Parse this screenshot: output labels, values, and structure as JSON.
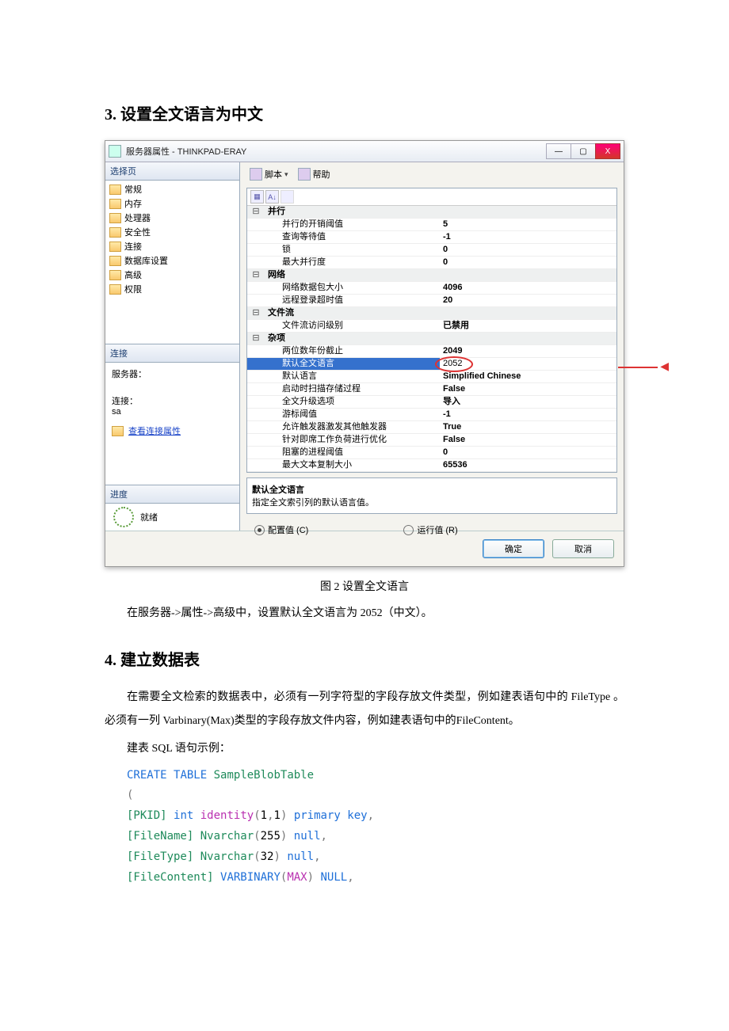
{
  "headings": {
    "h3": "3.  设置全文语言为中文",
    "h4": "4.  建立数据表"
  },
  "dialog": {
    "title": "服务器属性 - THINKPAD-ERAY",
    "winbtns": {
      "min": "—",
      "max": "▢",
      "close": "X"
    },
    "left": {
      "select_page": "选择页",
      "pages": [
        "常规",
        "内存",
        "处理器",
        "安全性",
        "连接",
        "数据库设置",
        "高级",
        "权限"
      ],
      "conn_hdr": "连接",
      "server_lbl": "服务器：",
      "conn_lbl": "连接：",
      "conn_val": "sa",
      "view_link": "查看连接属性",
      "progress_hdr": "进度",
      "progress_val": "就绪"
    },
    "right": {
      "script": "脚本",
      "script_drop": "▾",
      "help": "帮助",
      "cats": [
        {
          "name": "并行",
          "rows": [
            [
              "并行的开销阈值",
              "5"
            ],
            [
              "查询等待值",
              "-1"
            ],
            [
              "锁",
              "0"
            ],
            [
              "最大并行度",
              "0"
            ]
          ]
        },
        {
          "name": "网络",
          "rows": [
            [
              "网络数据包大小",
              "4096"
            ],
            [
              "远程登录超时值",
              "20"
            ]
          ]
        },
        {
          "name": "文件流",
          "rows": [
            [
              "文件流访问级别",
              "已禁用"
            ]
          ]
        },
        {
          "name": "杂项",
          "rows": [
            [
              "两位数年份截止",
              "2049"
            ],
            [
              "默认全文语言",
              "2052"
            ],
            [
              "默认语言",
              "Simplified Chinese"
            ],
            [
              "启动时扫描存储过程",
              "False"
            ],
            [
              "全文升级选项",
              "导入"
            ],
            [
              "游标阈值",
              "-1"
            ],
            [
              "允许触发器激发其他触发器",
              "True"
            ],
            [
              "针对即席工作负荷进行优化",
              "False"
            ],
            [
              "阻塞的进程阈值",
              "0"
            ],
            [
              "最大文本复制大小",
              "65536"
            ]
          ]
        }
      ],
      "desc_title": "默认全文语言",
      "desc_body": "指定全文索引列的默认语言值。",
      "radio_cfg": "配置值 (C)",
      "radio_run": "运行值 (R)",
      "ok": "确定",
      "cancel": "取消"
    }
  },
  "caption": "图 2  设置全文语言",
  "para1": "在服务器->属性->高级中，设置默认全文语言为 2052（中文）。",
  "para2": "在需要全文检索的数据表中，必须有一列字符型的字段存放文件类型，例如建表语句中的 FileType 。必须有一列 Varbinary(Max)类型的字段存放文件内容，例如建表语句中的FileContent。",
  "para3": "建表 SQL 语句示例：",
  "sql": {
    "l1a": "CREATE",
    "l1b": "TABLE",
    "l1c": "SampleBlobTable",
    "l2": "(",
    "l3a": "[PKID]",
    "l3b": "int",
    "l3c": "identity",
    "l3d": "(",
    "l3e": "1",
    "l3f": ",",
    "l3g": "1",
    "l3h": ")",
    "l3i": "primary",
    "l3j": "key",
    "l3k": ",",
    "l4a": "[FileName]",
    "l4b": "Nvarchar",
    "l4c": "(",
    "l4d": "255",
    "l4e": ")",
    "l4f": "null",
    "l4g": ",",
    "l5a": "[FileType]",
    "l5b": "Nvarchar",
    "l5c": "(",
    "l5d": "32",
    "l5e": ")",
    "l5f": "null",
    "l5g": ",",
    "l6a": "[FileContent]",
    "l6b": "VARBINARY",
    "l6c": "(",
    "l6d": "MAX",
    "l6e": ")",
    "l6f": "NULL",
    "l6g": ","
  }
}
